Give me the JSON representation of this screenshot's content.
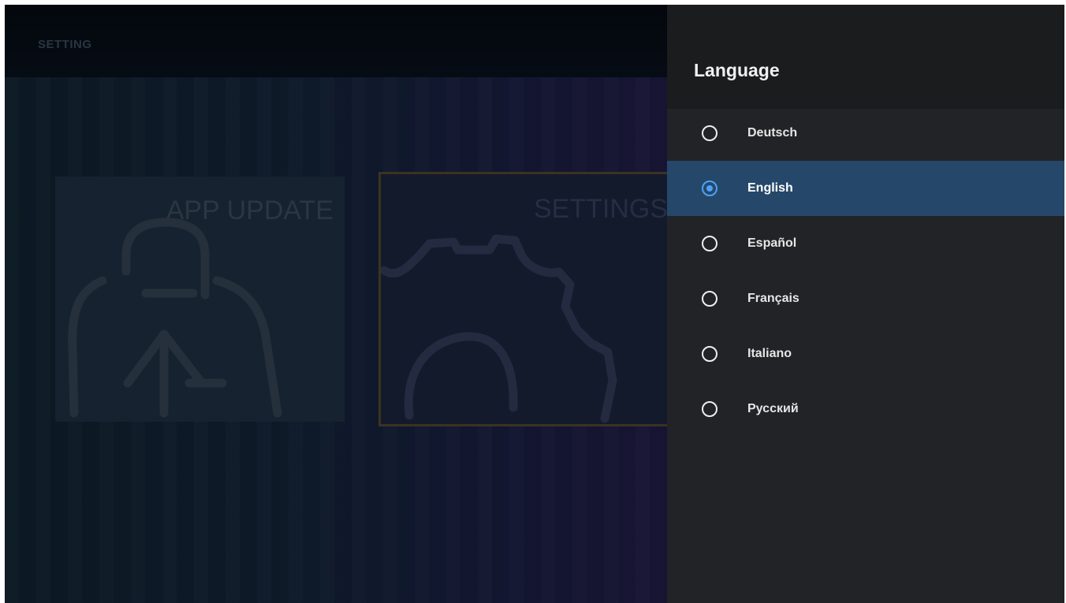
{
  "background": {
    "header_title": "SETTING",
    "tiles": [
      {
        "label": "APP UPDATE",
        "icon": "app-update-icon"
      },
      {
        "label": "SETTINGS",
        "icon": "gear-icon",
        "focused": true
      }
    ]
  },
  "language_panel": {
    "title": "Language",
    "options": [
      {
        "label": "Deutsch",
        "selected": false
      },
      {
        "label": "English",
        "selected": true
      },
      {
        "label": "Español",
        "selected": false
      },
      {
        "label": "Français",
        "selected": false
      },
      {
        "label": "Italiano",
        "selected": false
      },
      {
        "label": "Русский",
        "selected": false
      }
    ]
  },
  "colors": {
    "panel_background": "#222326",
    "selected_row": "#25486a",
    "radio_accent": "#4ea2f5"
  }
}
